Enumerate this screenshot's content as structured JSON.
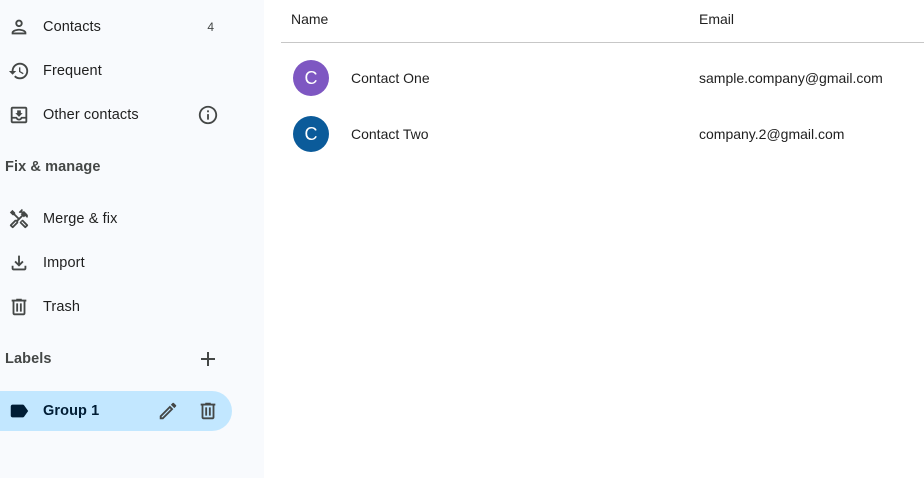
{
  "sidebar": {
    "items": [
      {
        "label": "Contacts",
        "count": "4",
        "icon": "person-icon"
      },
      {
        "label": "Frequent",
        "icon": "history-icon"
      },
      {
        "label": "Other contacts",
        "icon": "inbox-download-icon",
        "trailing_icon": "info-icon"
      }
    ],
    "fix_manage": {
      "header": "Fix & manage",
      "items": [
        {
          "label": "Merge & fix",
          "icon": "tools-icon"
        },
        {
          "label": "Import",
          "icon": "download-icon"
        },
        {
          "label": "Trash",
          "icon": "trash-icon"
        }
      ]
    },
    "labels": {
      "header": "Labels",
      "add_icon": "plus-icon",
      "items": [
        {
          "label": "Group 1",
          "icon": "label-icon",
          "actions": [
            "edit-pencil-icon",
            "trash-icon"
          ],
          "selected": true
        }
      ]
    }
  },
  "list": {
    "columns": {
      "name": "Name",
      "email": "Email"
    },
    "rows": [
      {
        "initial": "C",
        "name": "Contact One",
        "email": "sample.company@gmail.com",
        "avatar_color": "#7e57c2"
      },
      {
        "initial": "C",
        "name": "Contact Two",
        "email": "company.2@gmail.com",
        "avatar_color": "#0b5b9a"
      }
    ]
  },
  "colors": {
    "sidebar_bg": "#f8fafd",
    "selected_bg": "#c2e7ff",
    "divider": "#c7c7c7"
  }
}
